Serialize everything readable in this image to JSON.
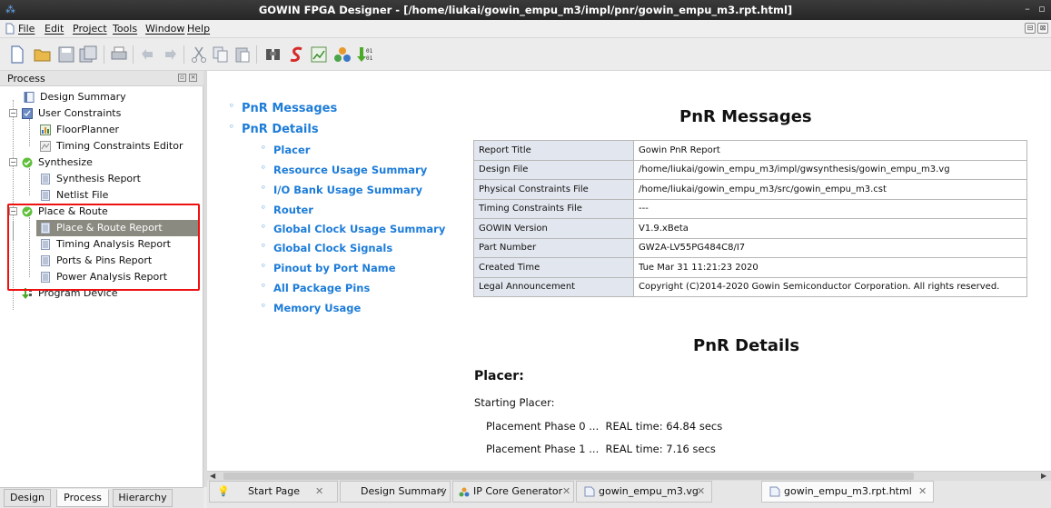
{
  "window": {
    "title": "GOWIN FPGA Designer - [/home/liukai/gowin_empu_m3/impl/pnr/gowin_empu_m3.rpt.html]"
  },
  "menu": [
    "File",
    "Edit",
    "Project",
    "Tools",
    "Window",
    "Help"
  ],
  "toolbar_icons": [
    "new-file-icon",
    "open-folder-icon",
    "save-icon",
    "save-all-icon",
    "print-icon",
    "undo-icon",
    "redo-icon",
    "cut-icon",
    "copy-icon",
    "paste-icon",
    "find-icon",
    "synthesize-icon",
    "floorplanner-icon",
    "ip-core-icon",
    "program-icon"
  ],
  "process_panel": {
    "title": "Process",
    "items": [
      {
        "label": "Design Summary"
      },
      {
        "label": "User Constraints"
      },
      {
        "label": "FloorPlanner"
      },
      {
        "label": "Timing Constraints Editor"
      },
      {
        "label": "Synthesize"
      },
      {
        "label": "Synthesis Report"
      },
      {
        "label": "Netlist File"
      },
      {
        "label": "Place & Route"
      },
      {
        "label": "Place & Route Report"
      },
      {
        "label": "Timing Analysis Report"
      },
      {
        "label": "Ports & Pins Report"
      },
      {
        "label": "Power Analysis Report"
      },
      {
        "label": "Program Device"
      }
    ]
  },
  "bottom_tabs": [
    "Design",
    "Process",
    "Hierarchy"
  ],
  "report": {
    "toc": {
      "top": [
        "PnR Messages",
        "PnR Details"
      ],
      "sub": [
        "Placer",
        "Resource Usage Summary",
        "I/O Bank Usage Summary",
        "Router",
        "Global Clock Usage Summary",
        "Global Clock Signals",
        "Pinout by Port Name",
        "All Package Pins",
        "Memory Usage"
      ]
    },
    "messages_heading": "PnR Messages",
    "messages_table": [
      [
        "Report Title",
        "Gowin PnR Report"
      ],
      [
        "Design File",
        "/home/liukai/gowin_empu_m3/impl/gwsynthesis/gowin_empu_m3.vg"
      ],
      [
        "Physical Constraints File",
        "/home/liukai/gowin_empu_m3/src/gowin_empu_m3.cst"
      ],
      [
        "Timing Constraints File",
        "---"
      ],
      [
        "GOWIN Version",
        "V1.9.xBeta"
      ],
      [
        "Part Number",
        "GW2A-LV55PG484C8/I7"
      ],
      [
        "Created Time",
        "Tue Mar 31 11:21:23 2020"
      ],
      [
        "Legal Announcement",
        "Copyright (C)2014-2020 Gowin Semiconductor Corporation. All rights reserved."
      ]
    ],
    "details_heading": "PnR Details",
    "placer_heading": "Placer:",
    "placer_start": "Starting Placer:",
    "phases": [
      "Placement Phase 0 ...  REAL time: 64.84 secs",
      "Placement Phase 1 ...  REAL time: 7.16 secs"
    ]
  },
  "doc_tabs": [
    "Start Page",
    "Design Summary",
    "IP Core Generator",
    "gowin_empu_m3.vg",
    "gowin_empu_m3.rpt.html"
  ]
}
